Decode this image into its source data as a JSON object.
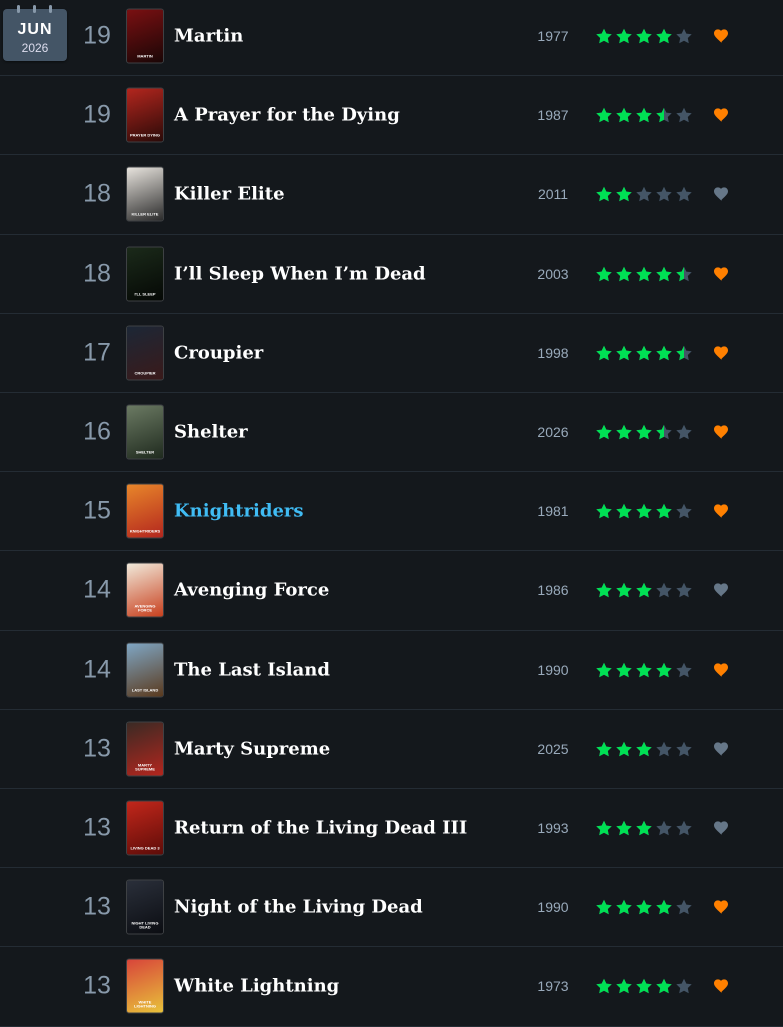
{
  "calendar": {
    "month": "JUN",
    "year": "2026"
  },
  "colors": {
    "background": "#14181c",
    "star_on": "#00e054",
    "star_off": "#445566",
    "like_on": "#ff8000",
    "like_off": "#678",
    "highlight": "#40bcf4"
  },
  "entries": [
    {
      "day": "19",
      "title": "Martin",
      "year": "1977",
      "rating": 4,
      "liked": true,
      "poster": [
        "#7a1012",
        "#1a0606"
      ],
      "poster_text": "MARTIN"
    },
    {
      "day": "19",
      "title": "A Prayer for the Dying",
      "year": "1987",
      "rating": 3.5,
      "liked": true,
      "poster": [
        "#b3261e",
        "#2a0a08"
      ],
      "poster_text": "PRAYER DYING"
    },
    {
      "day": "18",
      "title": "Killer Elite",
      "year": "2011",
      "rating": 2,
      "liked": false,
      "poster": [
        "#e8e4de",
        "#2b2b2b"
      ],
      "poster_text": "KILLER ELITE"
    },
    {
      "day": "18",
      "title": "I’ll Sleep When I’m Dead",
      "year": "2003",
      "rating": 4.5,
      "liked": true,
      "poster": [
        "#1b2a1a",
        "#050805"
      ],
      "poster_text": "I'LL SLEEP"
    },
    {
      "day": "17",
      "title": "Croupier",
      "year": "1998",
      "rating": 4.5,
      "liked": true,
      "poster": [
        "#1c2736",
        "#3a1a1a"
      ],
      "poster_text": "CROUPIER"
    },
    {
      "day": "16",
      "title": "Shelter",
      "year": "2026",
      "rating": 3.5,
      "liked": true,
      "poster": [
        "#6b7a63",
        "#1f2a1e"
      ],
      "poster_text": "SHELTER"
    },
    {
      "day": "15",
      "title": "Knightriders",
      "year": "1981",
      "rating": 4,
      "liked": true,
      "highlight": true,
      "poster": [
        "#e8862a",
        "#b3261e"
      ],
      "poster_text": "KNIGHTRIDERS"
    },
    {
      "day": "14",
      "title": "Avenging Force",
      "year": "1986",
      "rating": 3,
      "liked": false,
      "poster": [
        "#f1eadb",
        "#c8401e"
      ],
      "poster_text": "AVENGING FORCE"
    },
    {
      "day": "14",
      "title": "The Last Island",
      "year": "1990",
      "rating": 4,
      "liked": true,
      "poster": [
        "#7fa6c4",
        "#5a3a1e"
      ],
      "poster_text": "LAST ISLAND"
    },
    {
      "day": "13",
      "title": "Marty Supreme",
      "year": "2025",
      "rating": 3,
      "liked": false,
      "poster": [
        "#3a2a24",
        "#b3261e"
      ],
      "poster_text": "MARTY SUPREME"
    },
    {
      "day": "13",
      "title": "Return of the Living Dead III",
      "year": "1993",
      "rating": 3,
      "liked": false,
      "poster": [
        "#c2271b",
        "#5e0c08"
      ],
      "poster_text": "LIVING DEAD 3"
    },
    {
      "day": "13",
      "title": "Night of the Living Dead",
      "year": "1990",
      "rating": 4,
      "liked": true,
      "poster": [
        "#2a2f3a",
        "#0b0d12"
      ],
      "poster_text": "NIGHT LIVING DEAD"
    },
    {
      "day": "13",
      "title": "White Lightning",
      "year": "1973",
      "rating": 4,
      "liked": true,
      "poster": [
        "#d8453a",
        "#e8c23a"
      ],
      "poster_text": "WHITE LIGHTNING"
    }
  ]
}
